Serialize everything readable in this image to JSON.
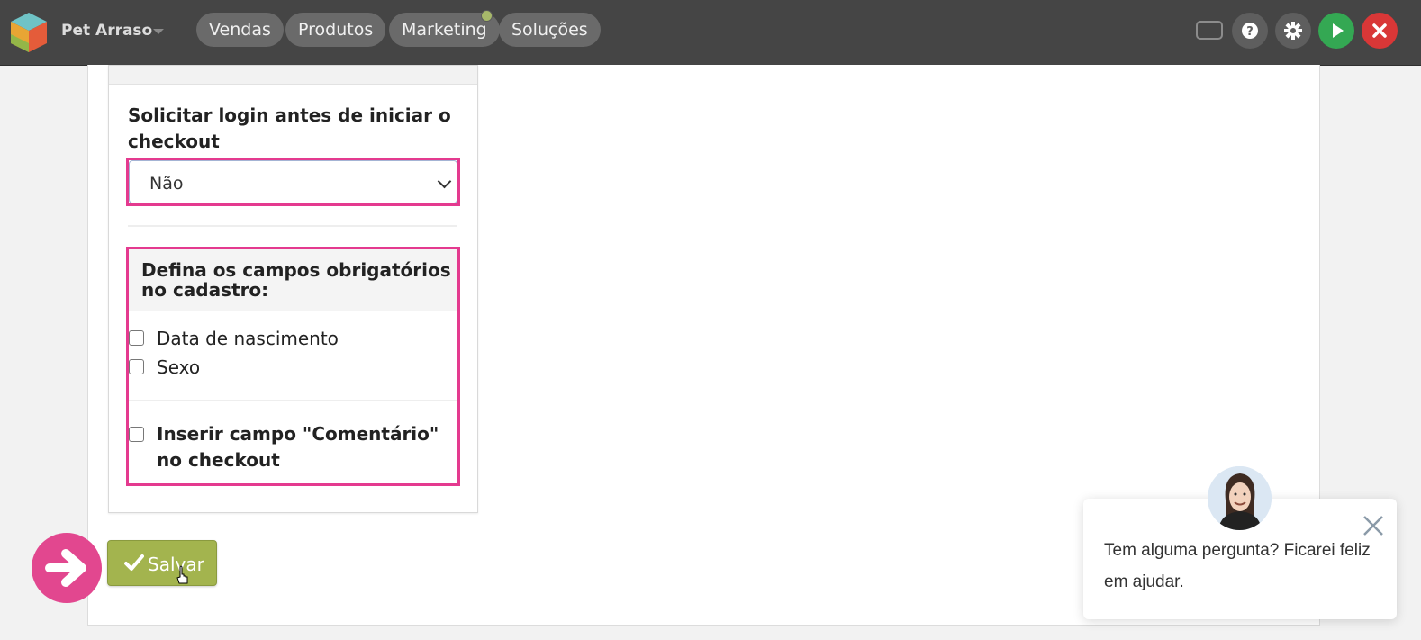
{
  "header": {
    "store_name": "Pet Arraso",
    "nav": [
      "Vendas",
      "Produtos",
      "Marketing",
      "Soluções"
    ],
    "icons": [
      "window-icon",
      "help-icon",
      "gear-icon",
      "play-icon",
      "close-icon"
    ],
    "colors": {
      "play": "#34a853",
      "close": "#d93737",
      "bar": "#454545"
    }
  },
  "form": {
    "login_label": "Solicitar login antes de iniciar o checkout",
    "login_value": "Não",
    "required_fields_title": "Defina os campos obrigatórios no cadastro:",
    "required_fields": [
      {
        "label": "Data de nascimento",
        "checked": false
      },
      {
        "label": "Sexo",
        "checked": false
      }
    ],
    "comment_field": {
      "label": "Inserir campo \"Comentário\" no checkout",
      "checked": false
    },
    "save_label": "Salvar",
    "highlight_color": "#e43a8f",
    "save_color": "#a3b44e"
  },
  "chat": {
    "message": "Tem alguma pergunta? Ficarei feliz em ajudar."
  }
}
